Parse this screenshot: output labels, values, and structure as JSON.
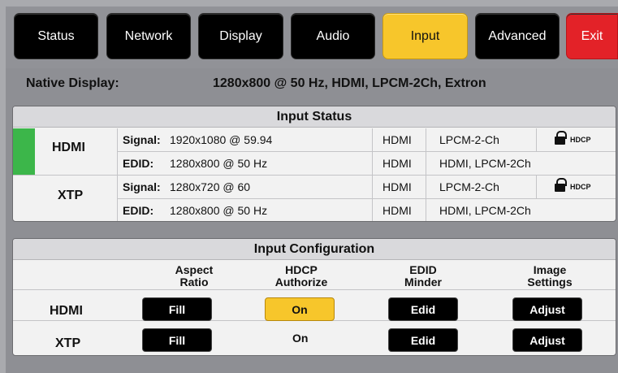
{
  "tabs": [
    "Status",
    "Network",
    "Display",
    "Audio",
    "Input",
    "Advanced",
    "Exit"
  ],
  "native": {
    "label": "Native Display:",
    "value": "1280x800 @ 50 Hz, HDMI, LPCM-2Ch, Extron"
  },
  "input_status": {
    "title": "Input Status",
    "rows": [
      {
        "input": "HDMI",
        "signal_label": "Signal:",
        "signal": "1920x1080 @ 59.94",
        "signal_type": "HDMI",
        "signal_audio": "LPCM-2-Ch",
        "hdcp": "HDCP",
        "edid_label": "EDID:",
        "edid": "1280x800 @ 50 Hz",
        "edid_type": "HDMI",
        "edid_audio": "HDMI, LPCM-2Ch",
        "active": true
      },
      {
        "input": "XTP",
        "signal_label": "Signal:",
        "signal": "1280x720 @ 60",
        "signal_type": "HDMI",
        "signal_audio": "LPCM-2-Ch",
        "hdcp": "HDCP",
        "edid_label": "EDID:",
        "edid": "1280x800 @ 50 Hz",
        "edid_type": "HDMI",
        "edid_audio": "HDMI, LPCM-2Ch",
        "active": false
      }
    ]
  },
  "input_config": {
    "title": "Input Configuration",
    "headers": [
      [
        "Aspect",
        "Ratio"
      ],
      [
        "HDCP",
        "Authorize"
      ],
      [
        "EDID",
        "Minder"
      ],
      [
        "Image",
        "Settings"
      ]
    ],
    "rows": [
      {
        "input": "HDMI",
        "aspect": "Fill",
        "hdcp": "On",
        "edid": "Edid",
        "image": "Adjust"
      },
      {
        "input": "XTP",
        "aspect": "Fill",
        "hdcp": "On",
        "edid": "Edid",
        "image": "Adjust"
      }
    ]
  },
  "colors": {
    "accent": "#f7c62b",
    "exit": "#e32228",
    "active_input": "#3cb64a"
  }
}
